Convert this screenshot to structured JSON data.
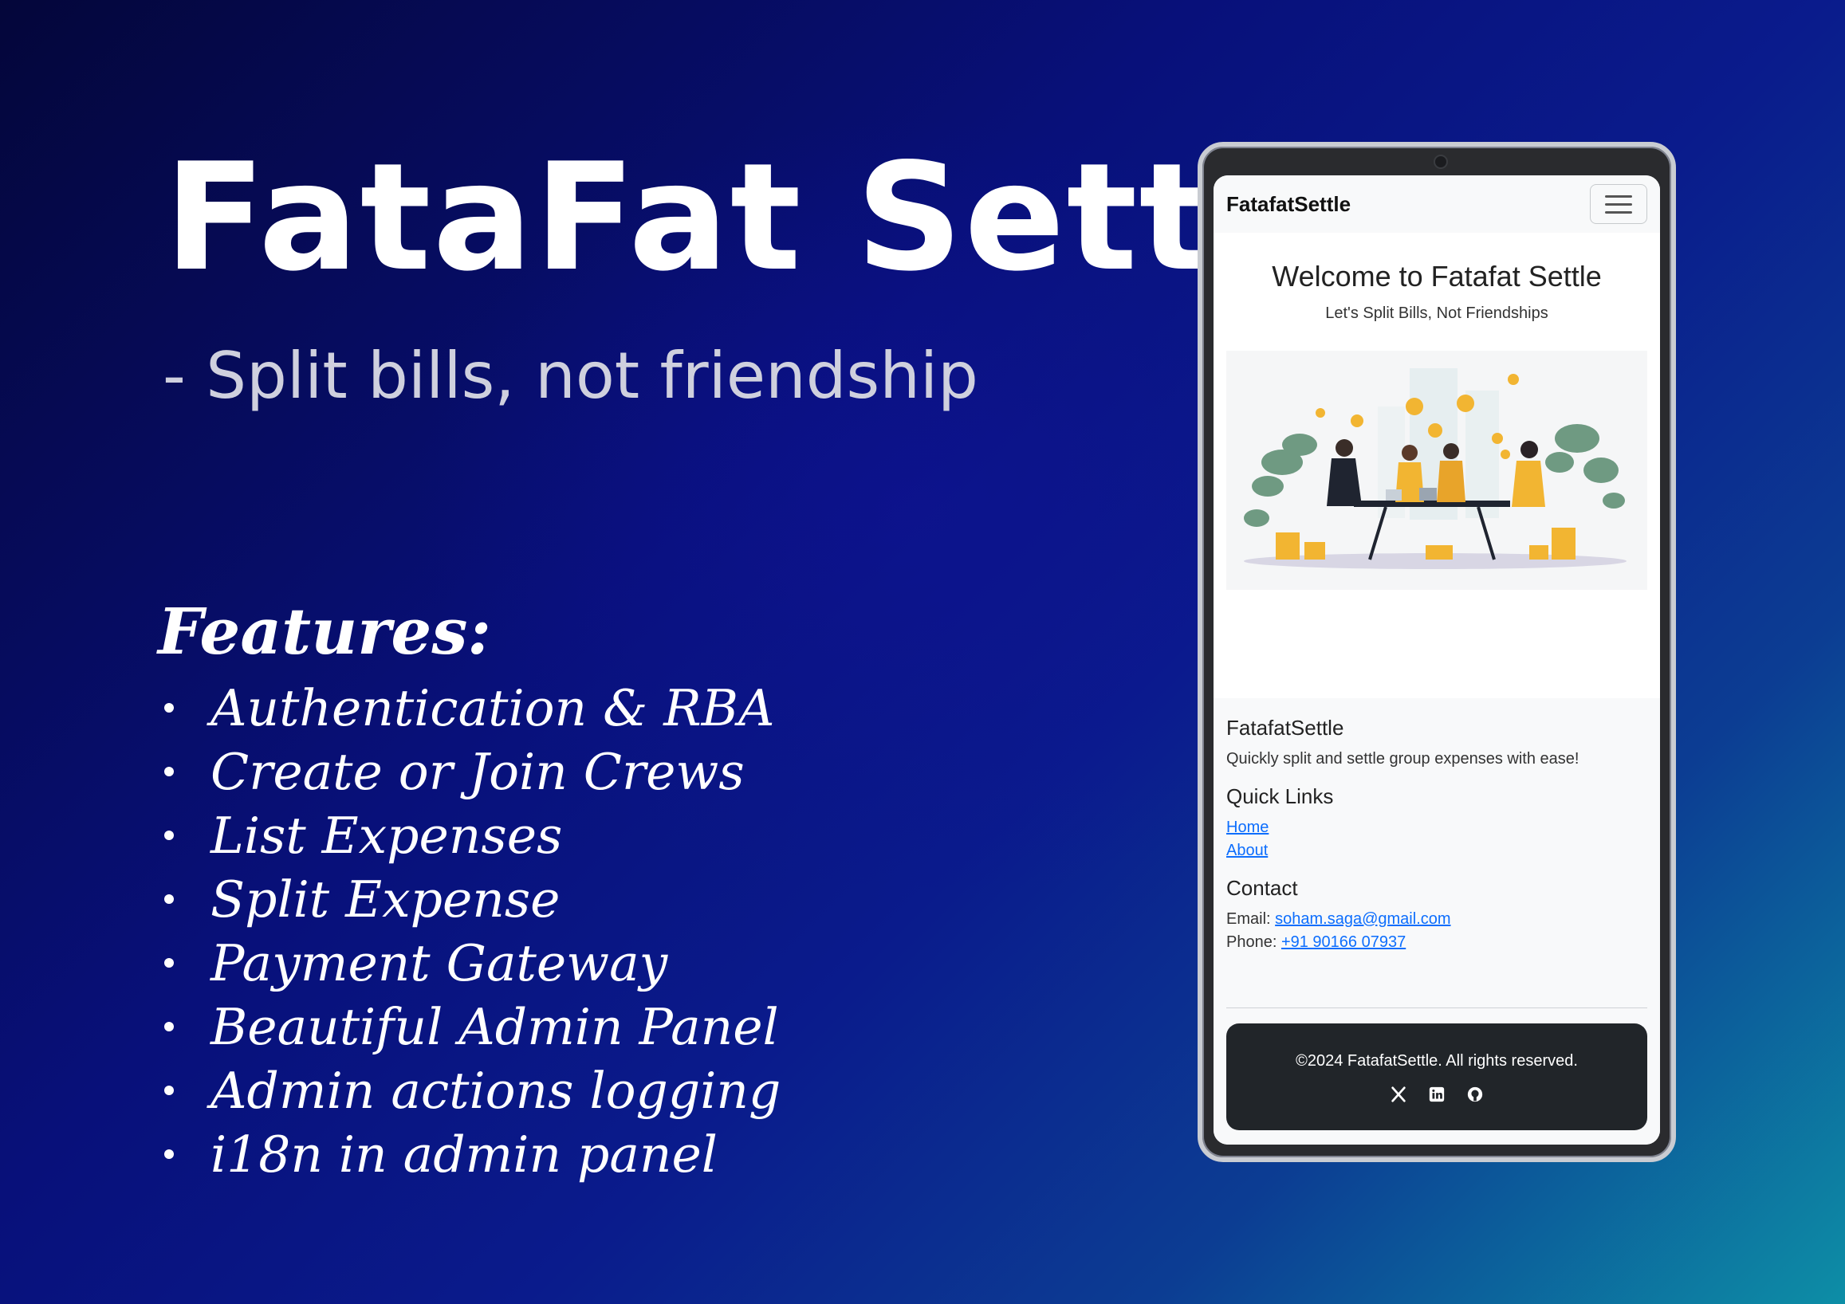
{
  "hero": {
    "title": "FataFat Settle",
    "subtitle": "- Split bills, not friendship"
  },
  "features": {
    "heading": "Features:",
    "items": [
      "Authentication & RBA",
      "Create or Join Crews",
      "List Expenses",
      "Split Expense",
      "Payment Gateway",
      "Beautiful Admin Panel",
      "Admin actions logging",
      "i18n in admin panel"
    ]
  },
  "app": {
    "brand": "FatafatSettle",
    "menu_icon": "hamburger-menu-icon",
    "welcome": "Welcome to Fatafat Settle",
    "tagline": "Let's Split Bills, Not Friendships",
    "footer": {
      "about_title": "FatafatSettle",
      "about_text": "Quickly split and settle group expenses with ease!",
      "links_title": "Quick Links",
      "links": [
        "Home",
        "About"
      ],
      "contact_title": "Contact",
      "email_label": "Email:",
      "email": "soham.saga@gmail.com",
      "phone_label": "Phone:",
      "phone": "+91 90166 07937",
      "copyright": "©2024 FatafatSettle. All rights reserved.",
      "social_icons": [
        "x-icon",
        "linkedin-icon",
        "github-icon"
      ]
    }
  },
  "colors": {
    "link": "#0d6efd",
    "footer_dark": "#212529",
    "accent_gold": "#f2b532"
  }
}
